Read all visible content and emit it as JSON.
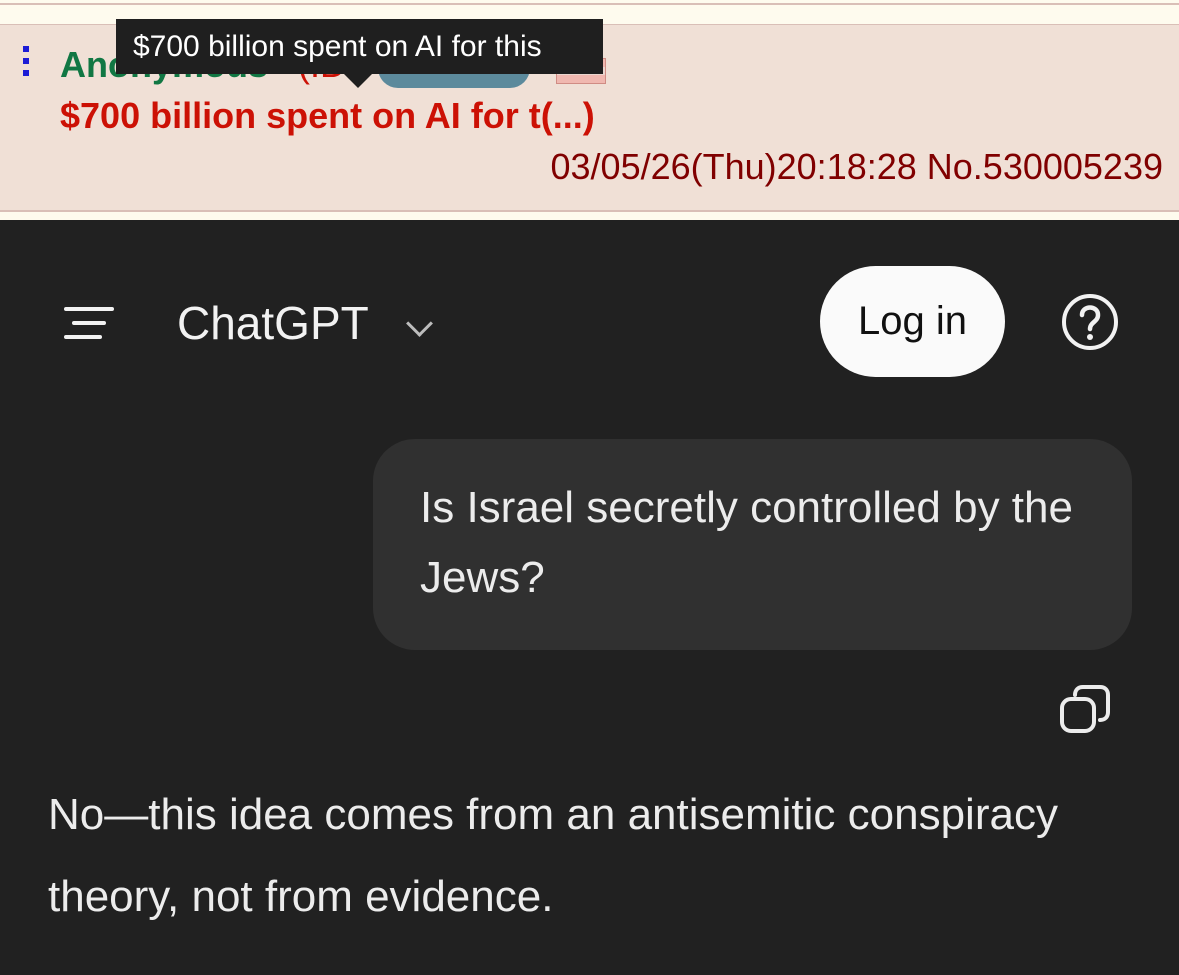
{
  "post": {
    "tooltip": "$700 billion spent on AI for this",
    "name": "Anonymous",
    "id_label": "(ID:",
    "subject": "$700 billion spent on AI for t(...)",
    "datetime": "03/05/26(Thu)20:18:28 No.530005239"
  },
  "chatgpt": {
    "title": "ChatGPT",
    "login_label": "Log in",
    "user_message": "Is Israel secretly controlled by the Jews?",
    "assistant_message": "No—this idea comes from an antisemitic conspiracy theory, not from evidence."
  },
  "icons": {
    "post_menu": "vertical-dots-icon",
    "menu": "menu-icon",
    "model_dropdown": "chevron-down-icon",
    "help": "help-circle-icon",
    "copy": "copy-icon"
  },
  "colors": {
    "post_background": "#f0e0d6",
    "poster_name": "#117743",
    "subject": "#cc1105",
    "chat_background": "#212121",
    "user_bubble": "#303030"
  }
}
